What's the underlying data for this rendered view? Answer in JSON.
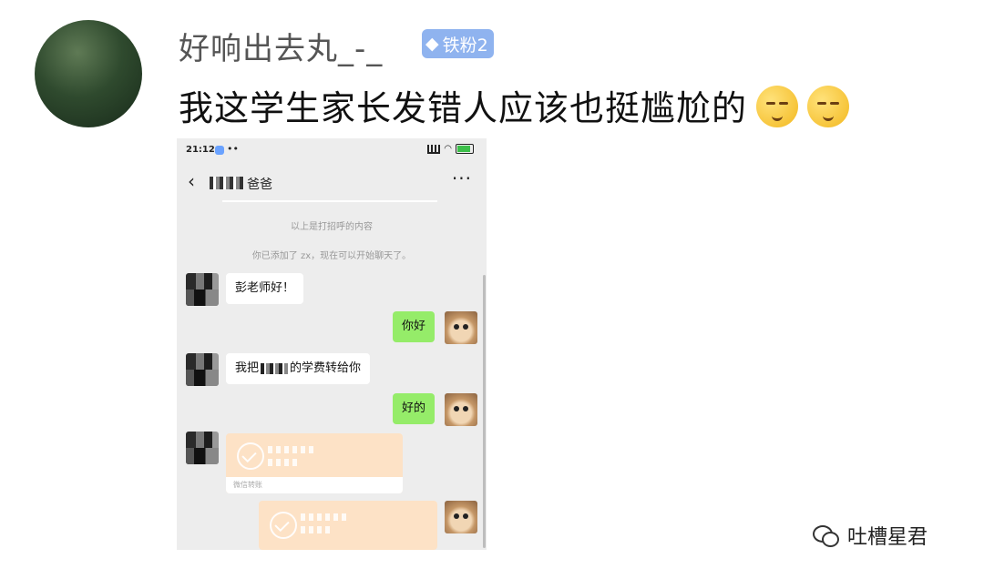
{
  "post": {
    "username": "好响出去丸_-_",
    "badge_label": "铁粉2",
    "badge_icon": "diamond-icon",
    "text": "我这学生家长发错人应该也挺尴尬的",
    "emojis": [
      "shush-face-icon",
      "shush-face-icon"
    ]
  },
  "phone": {
    "status": {
      "time": "21:12",
      "dots": "••"
    },
    "nav": {
      "back": "‹",
      "title": "爸爸",
      "more": "···"
    },
    "system_messages": [
      "以上是打招呼的内容",
      "你已添加了 zx，现在可以开始聊天了。"
    ],
    "messages": [
      {
        "side": "in",
        "text": "彭老师好！"
      },
      {
        "side": "out",
        "text": "你好"
      },
      {
        "side": "in",
        "text_before": "我把",
        "text_after": "的学费转给你"
      },
      {
        "side": "out",
        "text": "好的"
      }
    ],
    "transfers": [
      {
        "side": "in",
        "footer": "微信转账"
      },
      {
        "side": "out",
        "footer": ""
      }
    ]
  },
  "watermark": {
    "text": "吐槽星君"
  },
  "colors": {
    "badge": "#8fb3ef",
    "out_bubble": "#95ec69",
    "transfer": "#fde2c6",
    "chat_bg": "#ededed"
  }
}
